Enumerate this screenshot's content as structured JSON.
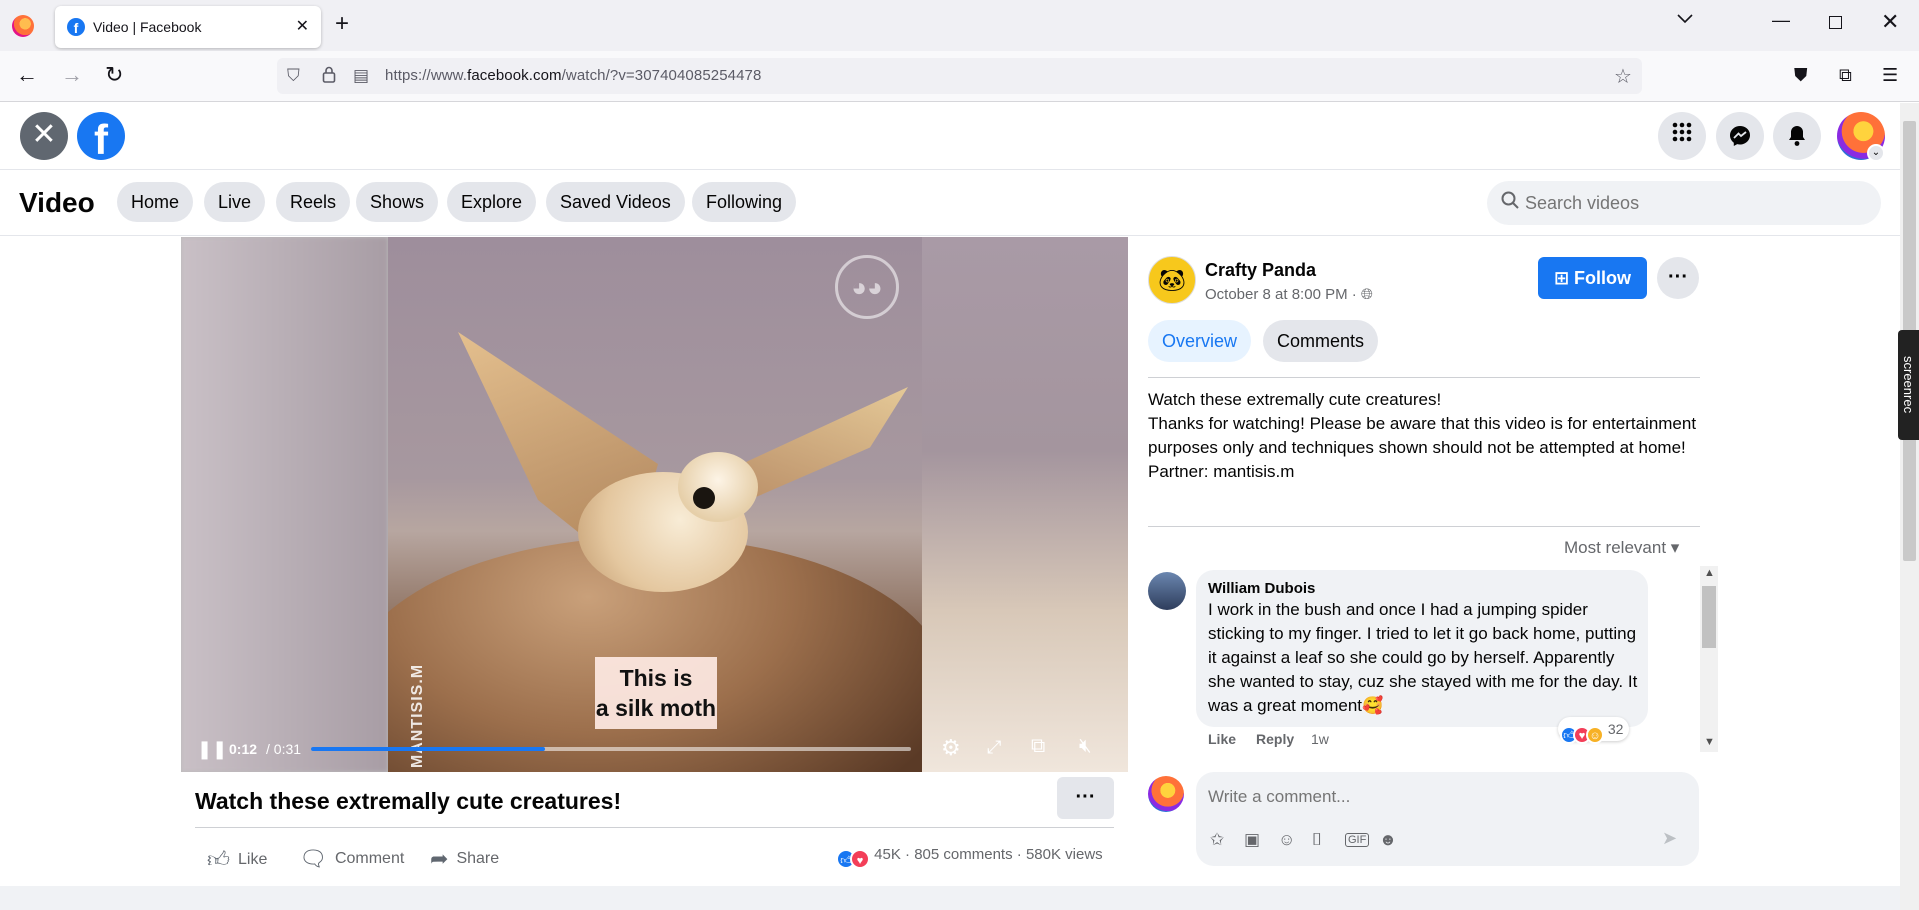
{
  "browser": {
    "tab_title": "Video | Facebook",
    "url_prefix": "https://www.",
    "url_domain": "facebook.com",
    "url_path": "/watch/?v=307404085254478",
    "new_tab_label": "+"
  },
  "header": {
    "section_title": "Video",
    "nav_pills": [
      "Home",
      "Live",
      "Reels",
      "Shows",
      "Explore",
      "Saved Videos",
      "Following"
    ],
    "search_placeholder": "Search videos"
  },
  "player": {
    "caption_line1": "This is",
    "caption_line2": "a silk moth",
    "credit": "MANTISIS.M",
    "time_current": "0:12",
    "time_total": "/ 0:31",
    "progress": 0.39,
    "accent_color": "#1877f2"
  },
  "video": {
    "title": "Watch these extremally cute creatures!",
    "actions": {
      "like": "Like",
      "comment": "Comment",
      "share": "Share"
    },
    "reaction_count": "45K",
    "comments_count": "805 comments",
    "separator": "·",
    "views": "580K views"
  },
  "channel": {
    "name": "Crafty Panda",
    "date": "October 8 at 8:00 PM ·",
    "follow_label": "Follow"
  },
  "tabs": {
    "overview": "Overview",
    "comments": "Comments"
  },
  "description": {
    "line1": "Watch these extremally cute creatures!",
    "line2": "Thanks for watching! Please be aware that this video is for entertainment purposes only and techniques shown should not be attempted at home!",
    "line3": "Partner: mantisis.m"
  },
  "sort_label": "Most relevant",
  "comment": {
    "author": "William Dubois",
    "text": "I work in the bush and once I had a jumping spider sticking to my finger. I tried to let it go back home, putting it against a leaf so she could go by herself. Apparently she wanted to stay, cuz she stayed with me for the day. It was a great moment🥰",
    "like": "Like",
    "reply": "Reply",
    "time": "1w",
    "reaction_count": "32"
  },
  "composer": {
    "placeholder": "Write a comment..."
  },
  "extension": {
    "label": "screenrec"
  }
}
